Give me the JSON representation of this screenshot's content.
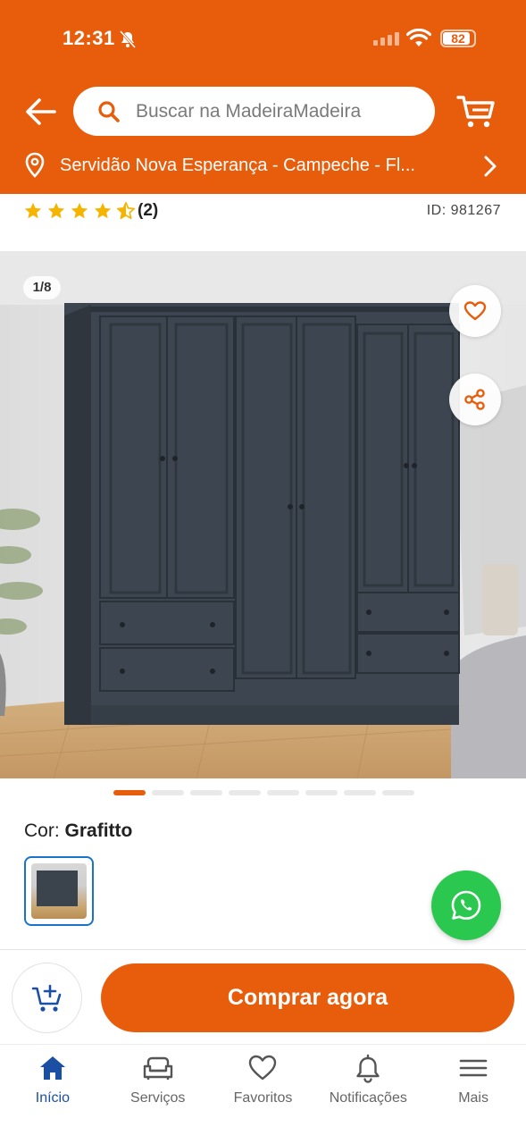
{
  "status_bar": {
    "time": "12:31",
    "battery": "82"
  },
  "header": {
    "search_placeholder": "Buscar na MadeiraMadeira",
    "address": "Servidão Nova Esperança - Campeche - Fl..."
  },
  "product": {
    "rating_value": 4.5,
    "rating_count": "(2)",
    "id_label": "ID: 981267",
    "image_counter": "1/8",
    "carousel_total": 8,
    "carousel_active": 1,
    "color_prefix": "Cor: ",
    "color_name": "Grafitto"
  },
  "actions": {
    "buy_now": "Comprar agora"
  },
  "bottom_nav": {
    "items": [
      {
        "label": "Início",
        "icon": "home-icon",
        "active": true
      },
      {
        "label": "Serviços",
        "icon": "sofa-icon",
        "active": false
      },
      {
        "label": "Favoritos",
        "icon": "heart-icon",
        "active": false
      },
      {
        "label": "Notificações",
        "icon": "bell-icon",
        "active": false
      },
      {
        "label": "Mais",
        "icon": "menu-icon",
        "active": false
      }
    ]
  },
  "colors": {
    "brand_orange": "#e85d0c",
    "active_blue": "#1a4fa3",
    "whatsapp_green": "#2bc84f",
    "star_yellow": "#f5b400"
  }
}
